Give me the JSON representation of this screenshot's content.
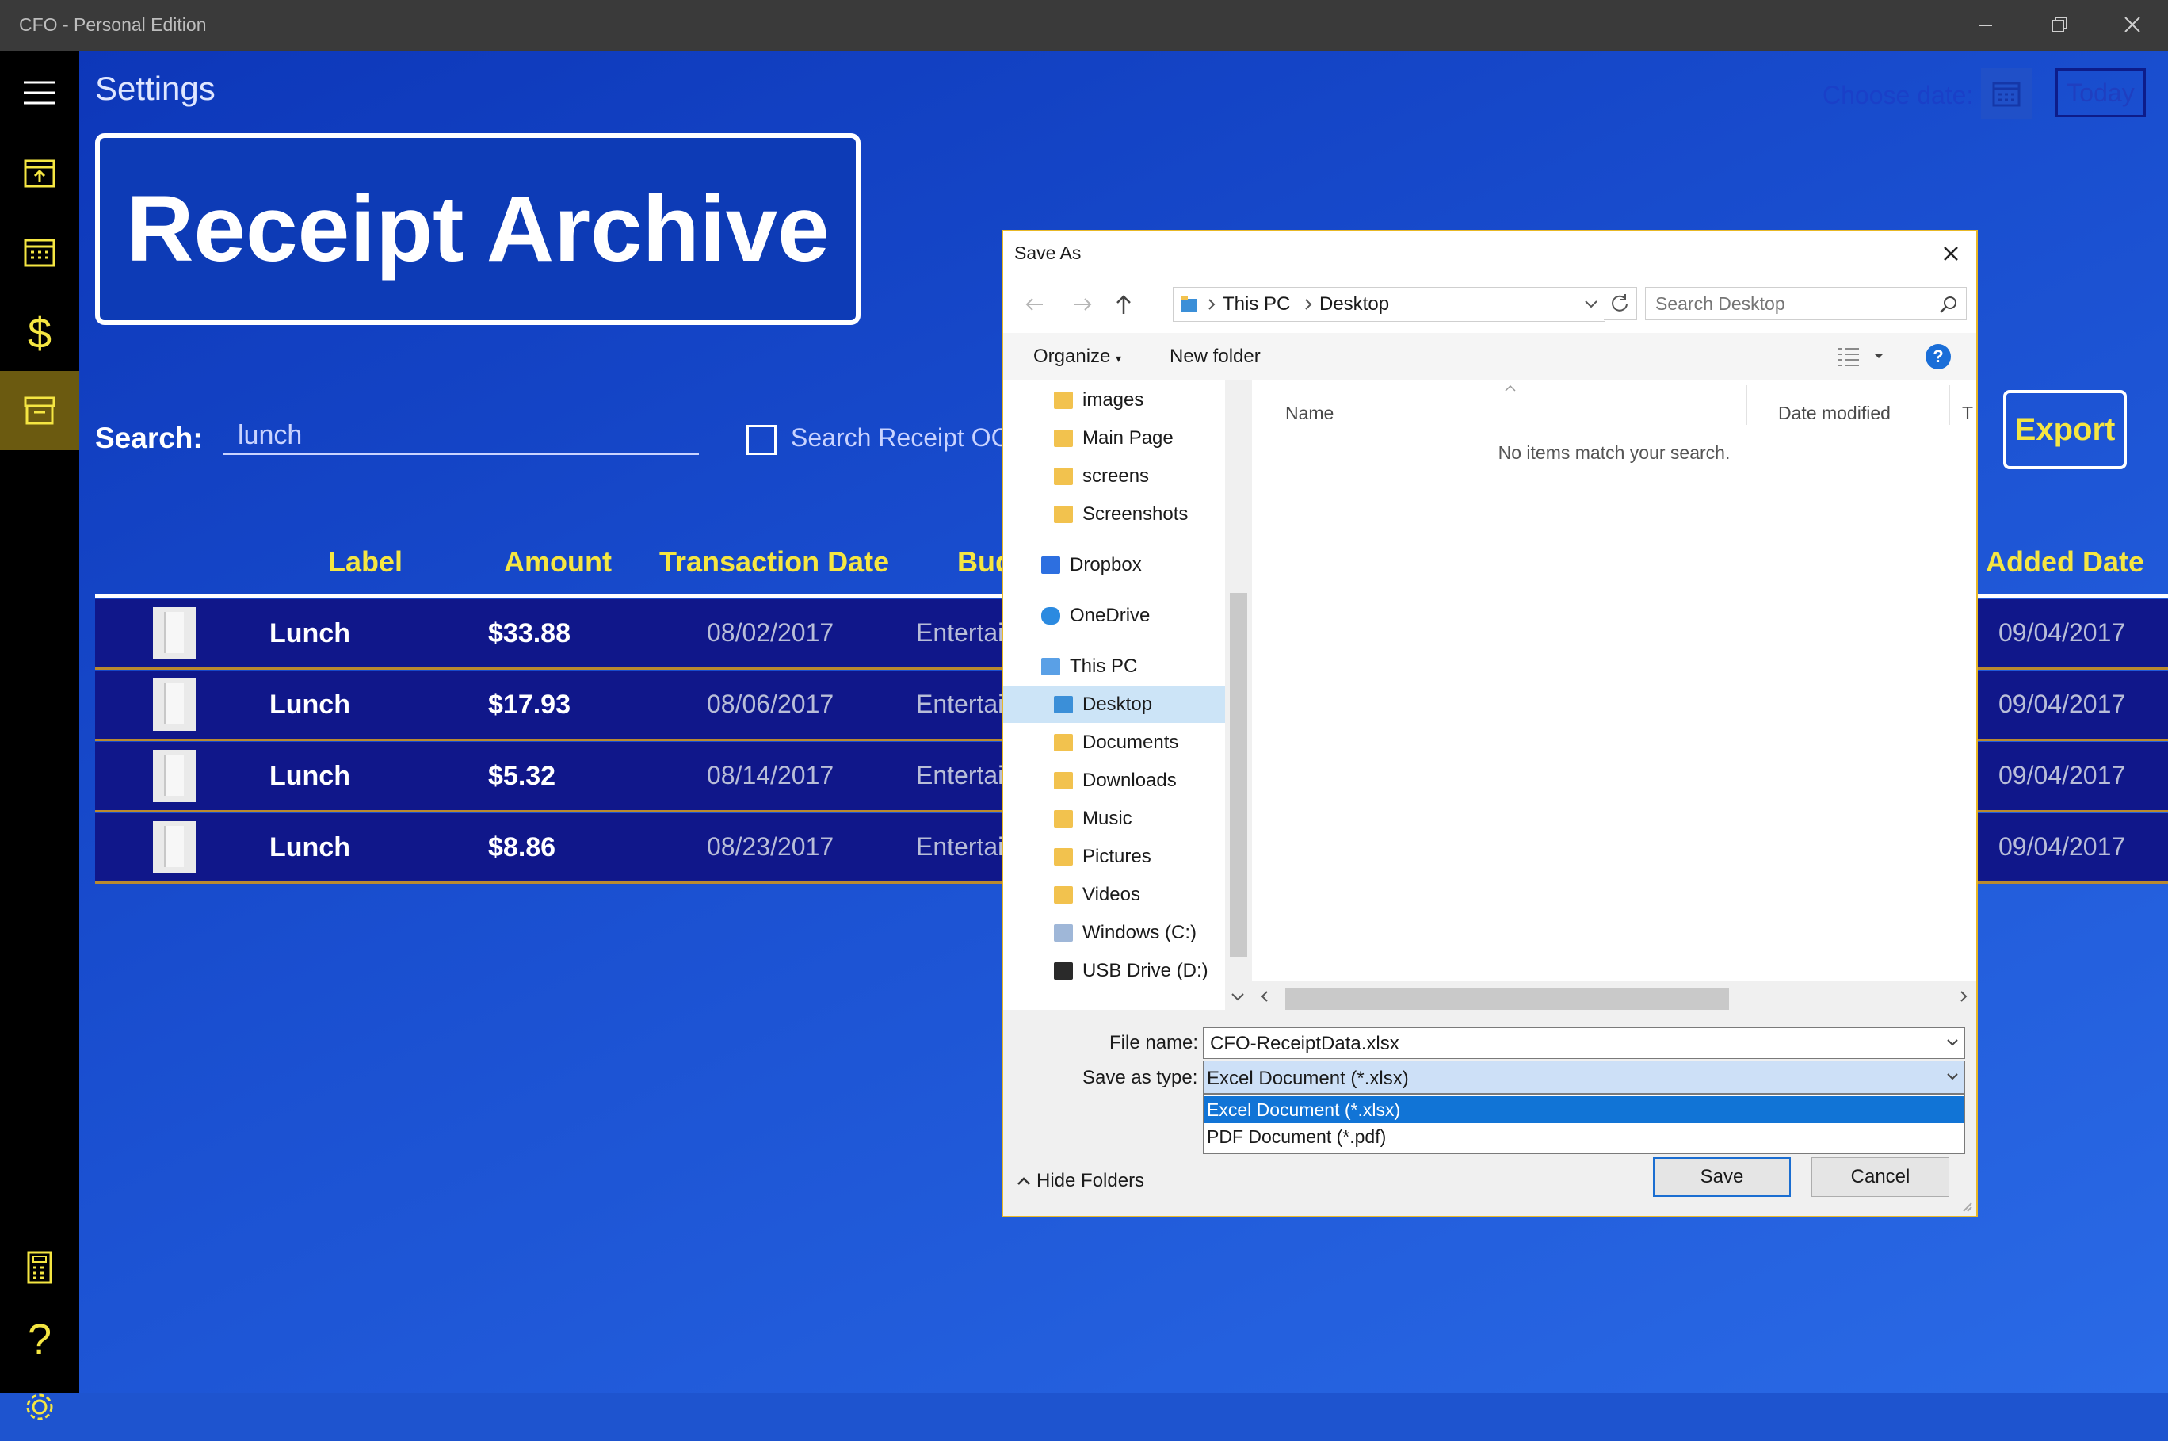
{
  "app": {
    "title": "CFO - Personal Edition"
  },
  "page": {
    "title": "Settings",
    "choose_date_label": "Choose date:",
    "today_label": "Today",
    "banner": "Receipt Archive",
    "search_label": "Search:",
    "search_value": "lunch",
    "ocr_label": "Search Receipt OCR",
    "export_label": "Export"
  },
  "table": {
    "columns": {
      "label": "Label",
      "amount": "Amount",
      "transaction_date": "Transaction Date",
      "budget": "Bud",
      "added_date": "Added Date"
    },
    "rows": [
      {
        "label": "Lunch",
        "amount": "$33.88",
        "transaction_date": "08/02/2017",
        "budget": "Entertain",
        "added_date": "09/04/2017"
      },
      {
        "label": "Lunch",
        "amount": "$17.93",
        "transaction_date": "08/06/2017",
        "budget": "Entertain",
        "added_date": "09/04/2017"
      },
      {
        "label": "Lunch",
        "amount": "$5.32",
        "transaction_date": "08/14/2017",
        "budget": "Entertain",
        "added_date": "09/04/2017"
      },
      {
        "label": "Lunch",
        "amount": "$8.86",
        "transaction_date": "08/23/2017",
        "budget": "Entertain",
        "added_date": "09/04/2017"
      }
    ]
  },
  "dialog": {
    "title": "Save As",
    "breadcrumb": [
      "This PC",
      "Desktop"
    ],
    "search_placeholder": "Search Desktop",
    "organize": "Organize",
    "new_folder": "New folder",
    "help": "?",
    "tree": [
      {
        "label": "images"
      },
      {
        "label": "Main Page"
      },
      {
        "label": "screens"
      },
      {
        "label": "Screenshots"
      },
      {
        "label": "Dropbox"
      },
      {
        "label": "OneDrive"
      },
      {
        "label": "This PC"
      },
      {
        "label": "Desktop"
      },
      {
        "label": "Documents"
      },
      {
        "label": "Downloads"
      },
      {
        "label": "Music"
      },
      {
        "label": "Pictures"
      },
      {
        "label": "Videos"
      },
      {
        "label": "Windows (C:)"
      },
      {
        "label": "USB Drive (D:)"
      }
    ],
    "list_columns": {
      "name": "Name",
      "date_modified": "Date modified",
      "type": "T"
    },
    "empty_message": "No items match your search.",
    "file_name_label": "File name:",
    "file_name_value": "CFO-ReceiptData.xlsx",
    "save_type_label": "Save as type:",
    "save_type_value": "Excel Document (*.xlsx)",
    "save_type_options": [
      "Excel Document (*.xlsx)",
      "PDF Document (*.pdf)"
    ],
    "hide_folders": "Hide Folders",
    "save": "Save",
    "cancel": "Cancel"
  },
  "colors": {
    "accent": "#f5e642",
    "rail_active": "#6b5a10",
    "row_bg": "#10178a",
    "dialog_border": "#e8b826",
    "selection": "#1174d6"
  },
  "icons": [
    "menu-icon",
    "calendar-upload-icon",
    "calendar-icon",
    "dollar-icon",
    "archive-icon",
    "calculator-icon",
    "help-icon",
    "settings-icon"
  ]
}
